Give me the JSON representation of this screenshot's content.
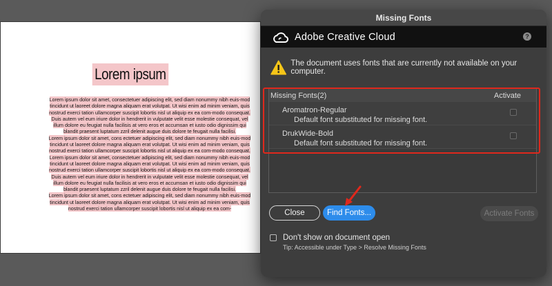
{
  "document": {
    "title": "Lorem ipsum",
    "paragraphs": [
      "Lorem ipsum dolor sit amet, consectetuer adipiscing elit, sed diam nonummy nibh euis-mod tincidunt ut laoreet dolore magna aliquam erat volutpat. Ut wisi enim ad minim veniam, quis nostrud exerci tation ullamcorper suscipit lobortis nisl ut aliquip ex ea com-modo consequat. Duis autem vel eum iriure dolor in hendrerit in vulputate velit esse molestie consequat, vel illum dolore eu feugiat nulla facilisis at vero eros et accumsan et iusto odio dignissim qui blandit praesent luptatum zzril delenit augue duis dolore te feugait nulla facilisi.",
      "Lorem ipsum dolor sit amet, cons ectetuer adipiscing elit, sed diam nonummy nibh euis-mod tincidunt ut laoreet dolore magna aliquam erat volutpat. Ut wisi enim ad minim veniam, quis nostrud exerci tation ullamcorper suscipit lobortis nisl ut aliquip ex ea com-modo consequat.",
      "Lorem ipsum dolor sit amet, consectetuer adipiscing elit, sed diam nonummy nibh euis-mod tincidunt ut laoreet dolore magna aliquam erat volutpat. Ut wisi enim ad minim veniam, quis nostrud exerci tation ullamcorper suscipit lobortis nisl ut aliquip ex ea com-modo consequat. Duis autem vel eum iriure dolor in hendrerit in vulputate velit esse molestie consequat, vel illum dolore eu feugiat nulla facilisis at vero eros et accumsan et iusto odio dignissim qui blandit praesent luptatum zzril delenit augue duis dolore te feugait nulla facilisi.",
      "Lorem ipsum dolor sit amet, cons ectetuer adipiscing elit, sed diam nonummy nibh euis-mod tincidunt ut laoreet dolore magna aliquam erat volutpat. Ut wisi enim ad minim veniam, quis nostrud exerci tation ullamcorper suscipit lobortis nisl ut aliquip ex ea com-"
    ]
  },
  "dialog": {
    "title": "Missing Fonts",
    "brand": "Adobe Creative Cloud",
    "help_icon": "?",
    "warning": "The document uses fonts that are currently not available on your computer.",
    "list": {
      "header_left": "Missing Fonts(2)",
      "header_right": "Activate",
      "fonts": [
        {
          "name": "Aromatron-Regular",
          "status": "Default font substituted for missing font."
        },
        {
          "name": "DrukWide-Bold",
          "status": "Default font substituted for missing font."
        }
      ]
    },
    "buttons": {
      "close": "Close",
      "find_fonts": "Find Fonts...",
      "activate_fonts": "Activate Fonts"
    },
    "dont_show_label": "Don't show on document open",
    "tip": "Tip: Accessible under Type > Resolve Missing Fonts"
  },
  "colors": {
    "highlight": "#f4c6c9",
    "annotation_red": "#e0281c",
    "primary_button": "#2d8ceb"
  },
  "icons": {
    "brand": "creative-cloud-icon",
    "warning": "warning-icon",
    "annotation": "arrow-icon"
  }
}
